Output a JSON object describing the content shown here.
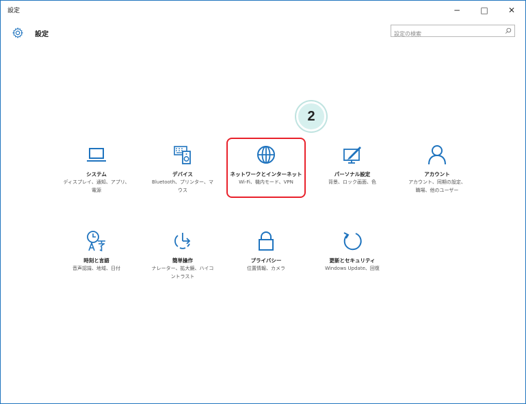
{
  "window": {
    "title": "設定",
    "minimize": "−",
    "maximize": "□",
    "close": "✕"
  },
  "header": {
    "title": "設定",
    "search_placeholder": "設定の検索"
  },
  "callout": {
    "number": "2"
  },
  "tiles": [
    {
      "icon": "laptop-icon",
      "label": "システム",
      "desc1": "ディスプレイ、通知、アプリ、",
      "desc2": "電源"
    },
    {
      "icon": "devices-icon",
      "label": "デバイス",
      "desc1": "Bluetooth、プリンター、マ",
      "desc2": "ウス"
    },
    {
      "icon": "globe-icon",
      "label": "ネットワークとインターネット",
      "desc1": "Wi-Fi、機内モード、VPN",
      "desc2": ""
    },
    {
      "icon": "personalization-icon",
      "label": "パーソナル設定",
      "desc1": "背景、ロック画面、色",
      "desc2": ""
    },
    {
      "icon": "person-icon",
      "label": "アカウント",
      "desc1": "アカウント、同期の設定、",
      "desc2": "職場、他のユーザー"
    },
    {
      "icon": "time-language-icon",
      "label": "時刻と言語",
      "desc1": "音声認識、地域、日付",
      "desc2": ""
    },
    {
      "icon": "ease-of-access-icon",
      "label": "簡単操作",
      "desc1": "ナレーター、拡大鏡、ハイコ",
      "desc2": "ントラスト"
    },
    {
      "icon": "lock-icon",
      "label": "プライバシー",
      "desc1": "位置情報、カメラ",
      "desc2": ""
    },
    {
      "icon": "update-icon",
      "label": "更新とセキュリティ",
      "desc1": "Windows Update、回復",
      "desc2": ""
    }
  ],
  "colors": {
    "accent": "#1e73be",
    "highlight": "#e8202a",
    "callout_bg": "#d6f0ee"
  }
}
